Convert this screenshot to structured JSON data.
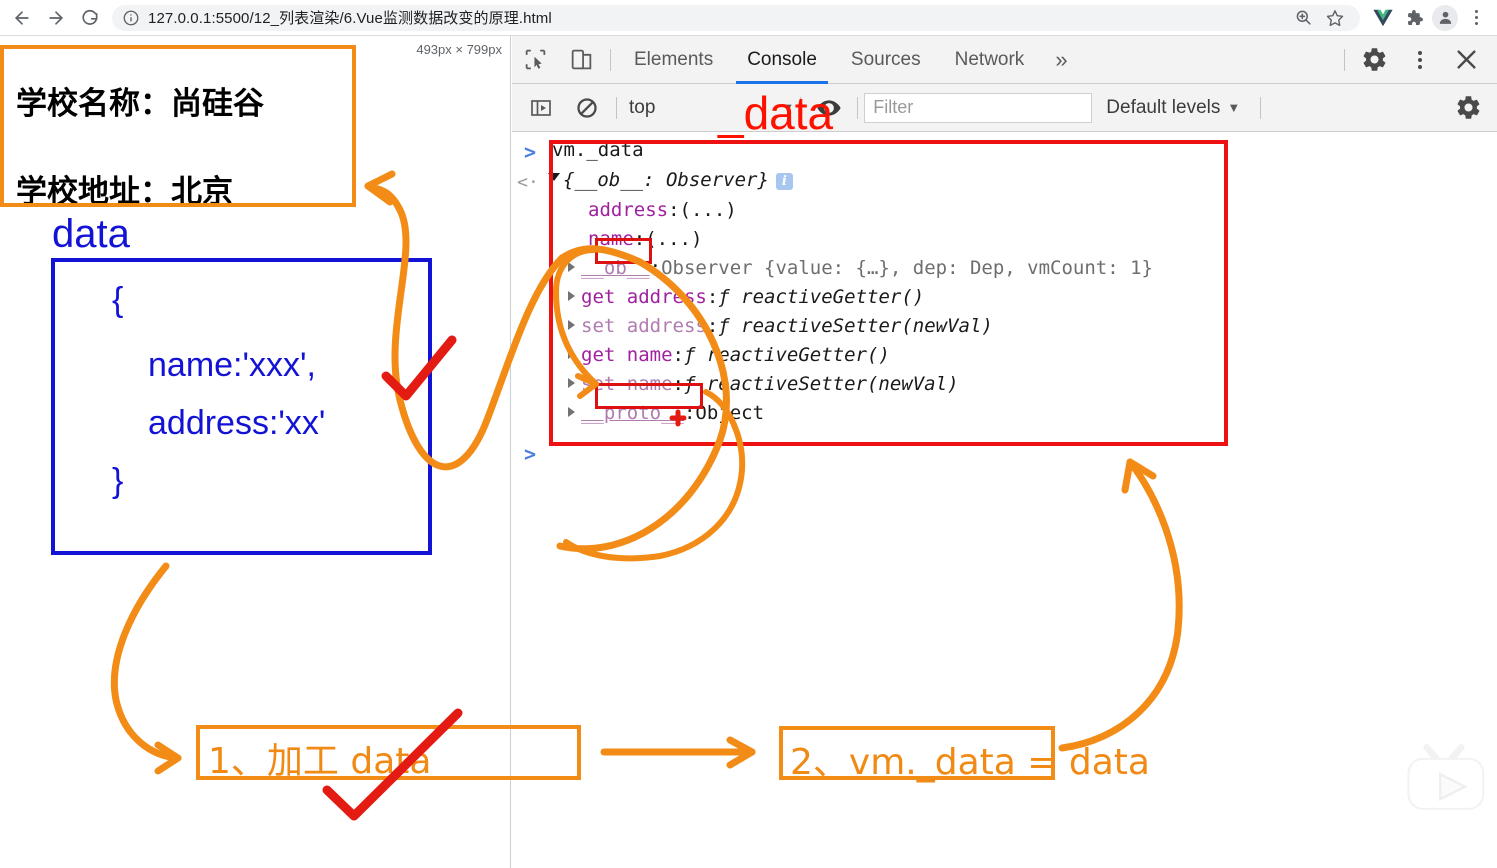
{
  "browser": {
    "back_label": "Back",
    "forward_label": "Forward",
    "reload_label": "Reload",
    "url": "127.0.0.1:5500/12_列表渲染/6.Vue监测数据改变的原理.html",
    "site_info_icon": "info-circle-icon",
    "zoom_icon": "zoom-in-icon",
    "bookmark_icon": "star-icon",
    "vue_devtools_icon": "vue-logo-icon",
    "extensions_icon": "puzzle-piece-icon",
    "profile_icon": "account-avatar-icon",
    "menu_icon": "three-dot-menu-icon"
  },
  "page": {
    "size_tooltip": "493px × 799px",
    "lines": [
      "学校名称：尚硅谷",
      "学校地址：北京"
    ]
  },
  "devtools": {
    "inspect_icon": "inspect-element-icon",
    "device_icon": "device-toolbar-icon",
    "tabs": [
      {
        "label": "Elements",
        "active": false
      },
      {
        "label": "Console",
        "active": true
      },
      {
        "label": "Sources",
        "active": false
      },
      {
        "label": "Network",
        "active": false
      }
    ],
    "more_tabs_label": "»",
    "settings_icon": "gear-icon",
    "kebab_icon": "three-dot-menu-icon",
    "close_icon": "close-icon",
    "sidebar_icon": "console-sidebar-icon",
    "clear_icon": "clear-console-icon",
    "context_label": "top",
    "context_caret": "▼",
    "eye_icon": "live-expression-eye-icon",
    "filter_placeholder": "Filter",
    "filter_value": "",
    "levels_label": "Default levels",
    "levels_caret": "▼",
    "filter_settings_icon": "gear-icon"
  },
  "console": {
    "input_expression": "vm._data",
    "result_header": "{__ob__: Observer}",
    "result_header_caret": "▼",
    "info_badge": "i",
    "rows": [
      {
        "key": "address",
        "sep": ": ",
        "value": "(...)",
        "expandable": false
      },
      {
        "key": "name",
        "sep": ": ",
        "value": "(...)",
        "expandable": false,
        "highlight": true
      },
      {
        "key": "__ob__",
        "sep": ": ",
        "value": "Observer {value: {…}, dep: Dep, vmCount: 1}",
        "expandable": true
      },
      {
        "key": "get address",
        "sep": ": ",
        "value": "ƒ reactiveGetter()",
        "expandable": true
      },
      {
        "key": "set address",
        "sep": ": ",
        "value": "ƒ reactiveSetter(newVal)",
        "expandable": true
      },
      {
        "key": "get name",
        "sep": ": ",
        "value": "ƒ reactiveGetter()",
        "expandable": true
      },
      {
        "key": "set name",
        "sep": ": ",
        "value": "ƒ reactiveSetter(newVal)",
        "expandable": true,
        "highlight": true
      },
      {
        "key": "__proto__",
        "sep": ": ",
        "value": "Object",
        "expandable": true
      }
    ],
    "ob_detail": {
      "value_label": "value:",
      "value_val": "{…}",
      "dep_label": "dep:",
      "dep_val": "Dep",
      "vmcount_label": "vmCount:",
      "vmcount_val": "1"
    },
    "prompt_symbol": ">",
    "back_symbol": "<·"
  },
  "annotations": {
    "blue_data_label": "data",
    "code_open": "{",
    "code_name": "name:'xxx',",
    "code_address": "address:'xx'",
    "code_close": "}",
    "red_data_label": "_data",
    "step1_label": "1、加工 data",
    "step2_label": "2、vm._data = data"
  },
  "colors": {
    "orange": "#f28c17",
    "blue": "#1313d6",
    "red": "#ee1111",
    "red_text": "#ff1100",
    "accent_tab": "#1a73e8",
    "devtools_bg": "#f3f3f3",
    "purple_prop": "#a020a0"
  },
  "watermark": {
    "icon": "bilibili-tv-logo-icon"
  }
}
